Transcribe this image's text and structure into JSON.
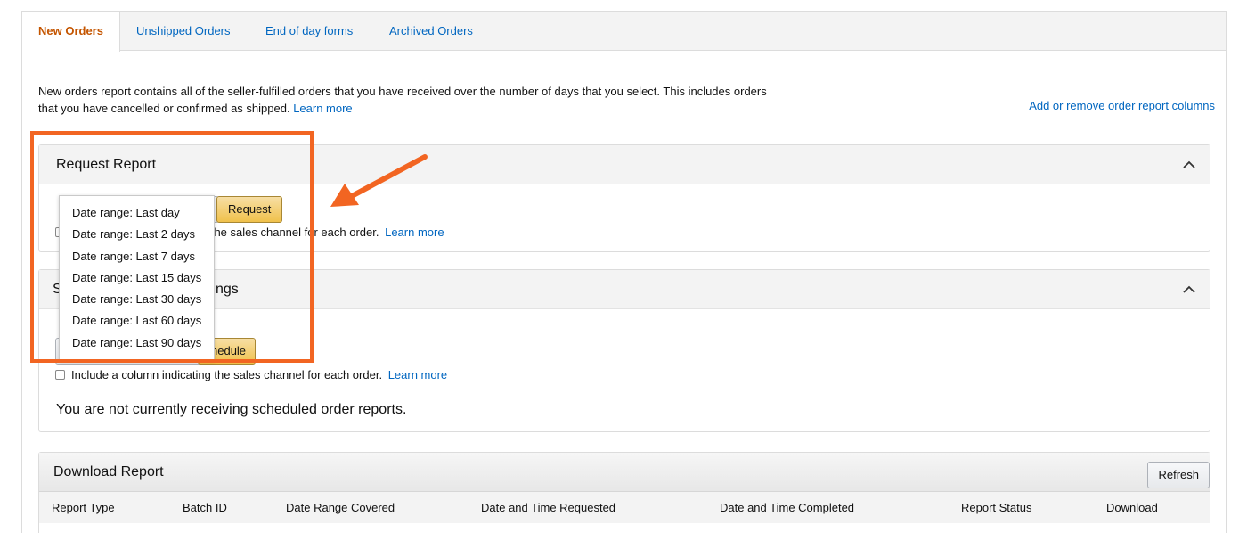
{
  "tabs": [
    {
      "label": "New Orders",
      "active": true
    },
    {
      "label": "Unshipped Orders"
    },
    {
      "label": "End of day forms"
    },
    {
      "label": "Archived Orders"
    }
  ],
  "intro": {
    "line1": "New orders report contains all of the seller-fulfilled orders that you have received over the number of days that you select. This includes orders",
    "line2": "that you have cancelled or confirmed as shipped.",
    "learn_more": "Learn more"
  },
  "columns_link": "Add or remove order report columns",
  "request_panel": {
    "title": "Request Report",
    "button": "Request",
    "checkbox_text": "g the sales channel for each order.",
    "learn_more": "Learn more"
  },
  "schedule_panel": {
    "title_left": "S",
    "title_right": "ngs",
    "button": "nedule",
    "checkbox_text": "Include a column indicating the sales channel for each order.",
    "learn_more": "Learn more",
    "status": "You are not currently receiving scheduled order reports."
  },
  "date_range_dropdown": {
    "options": [
      "Date range: Last day",
      "Date range: Last 2 days",
      "Date range: Last 7 days",
      "Date range: Last 15 days",
      "Date range: Last 30 days",
      "Date range: Last 60 days",
      "Date range: Last 90 days"
    ]
  },
  "download_panel": {
    "title": "Download Report",
    "refresh": "Refresh",
    "columns": [
      "Report Type",
      "Batch ID",
      "Date Range Covered",
      "Date and Time Requested",
      "Date and Time Completed",
      "Report Status",
      "Download"
    ]
  },
  "colors": {
    "link": "#0066c0",
    "active_tab": "#c45500",
    "highlight": "#f26522",
    "button_yellow": "#f0c14b"
  }
}
